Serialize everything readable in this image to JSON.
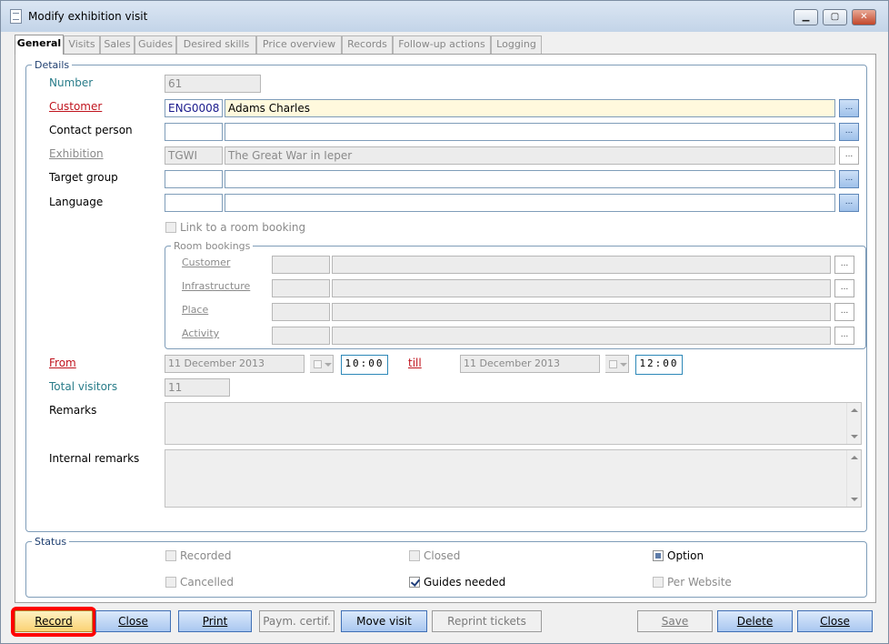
{
  "window": {
    "title": "Modify exhibition visit",
    "min_label": "▁",
    "max_label": "▢",
    "close_label": "✕"
  },
  "tabs": [
    "General",
    "Visits",
    "Sales",
    "Guides",
    "Desired skills",
    "Price overview",
    "Records",
    "Follow-up actions",
    "Logging"
  ],
  "details": {
    "legend": "Details",
    "number_label": "Number",
    "number_value": "61",
    "customer_label": "Customer",
    "customer_code": "ENG0008",
    "customer_name": "Adams Charles",
    "contact_label": "Contact person",
    "contact_code": "",
    "contact_name": "",
    "exhibition_label": "Exhibition",
    "exhibition_code": "TGWI",
    "exhibition_name": "The Great War in Ieper",
    "target_label": "Target group",
    "target_code": "",
    "target_name": "",
    "language_label": "Language",
    "language_code": "",
    "language_name": "",
    "link_room_label": "Link to a room booking",
    "dots_label": "..."
  },
  "room_bookings": {
    "legend": "Room bookings",
    "customer_label": "Customer",
    "infrastructure_label": "Infrastructure",
    "place_label": "Place",
    "activity_label": "Activity"
  },
  "schedule": {
    "from_label": "From",
    "from_date": "11 December 2013",
    "from_time": "10:00",
    "till_label": "till",
    "till_date": "11 December 2013",
    "till_time": "12:00"
  },
  "visitors": {
    "label": "Total visitors",
    "value": "11"
  },
  "remarks": {
    "remarks_label": "Remarks",
    "internal_label": "Internal remarks"
  },
  "status": {
    "legend": "Status",
    "recorded_label": "Recorded",
    "closed_label": "Closed",
    "option_label": "Option",
    "cancelled_label": "Cancelled",
    "guides_needed_label": "Guides needed",
    "per_website_label": "Per Website",
    "guides_needed_checked": true,
    "option_checked": false
  },
  "buttons": {
    "record": "Record",
    "close_left": "Close",
    "print": "Print",
    "paym_certif": "Paym. certif.",
    "move_visit": "Move visit",
    "reprint_tickets": "Reprint tickets",
    "save": "Save",
    "delete": "Delete",
    "close_right": "Close"
  },
  "colors": {
    "highlight": "#ff0000",
    "required_label": "#c0141e",
    "teal_label": "#2a7d8a",
    "button_blue": "#a9c7f0"
  }
}
